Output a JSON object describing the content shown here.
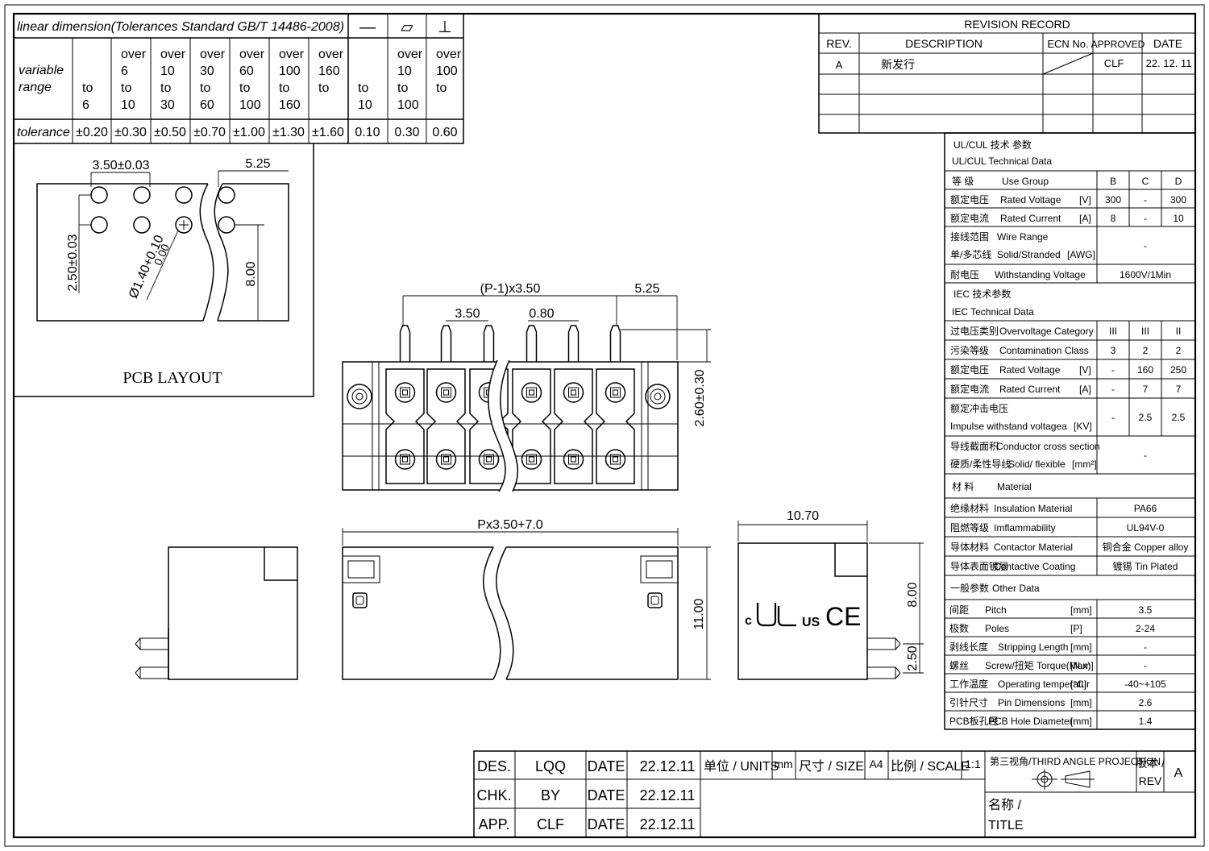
{
  "tolerance_table": {
    "header": "linear dimension(Tolerances Standard GB/T 14486-2008)",
    "symbols": [
      "—",
      "▱",
      "⊥"
    ],
    "row_label_range": [
      "variable",
      "range"
    ],
    "row_label_tol": "tolerance",
    "ranges": [
      [
        "",
        "",
        "to",
        "6"
      ],
      [
        "over",
        "6",
        "to",
        "10"
      ],
      [
        "over",
        "10",
        "to",
        "30"
      ],
      [
        "over",
        "30",
        "to",
        "60"
      ],
      [
        "over",
        "60",
        "to",
        "100"
      ],
      [
        "over",
        "100",
        "to",
        "160"
      ],
      [
        "over",
        "160",
        "to",
        ""
      ],
      [
        "",
        "",
        "to",
        "10"
      ],
      [
        "over",
        "10",
        "to",
        "100"
      ],
      [
        "over",
        "100",
        "to",
        ""
      ]
    ],
    "tolerances": [
      "±0.20",
      "±0.30",
      "±0.50",
      "±0.70",
      "±1.00",
      "±1.30",
      "±1.60",
      "0.10",
      "0.30",
      "0.60"
    ]
  },
  "revision": {
    "title": "REVISION  RECORD",
    "headers": [
      "REV.",
      "DESCRIPTION",
      "ECN No.",
      "APPROVED",
      "DATE"
    ],
    "rows": [
      [
        "A",
        "新发行",
        "",
        "CLF",
        "22. 12. 11"
      ]
    ]
  },
  "pcb_layout": {
    "title": "PCB LAYOUT",
    "dims": {
      "pitch": "3.50±0.03",
      "end": "5.25",
      "row_offset": "2.50±0.03",
      "hole": "Ø1.40+0.10",
      "hole_minus": "0.00",
      "depth": "8.00"
    }
  },
  "top_view": {
    "dims": {
      "span": "(P-1)x3.50",
      "end": "5.25",
      "pitch": "3.50",
      "pin": "0.80",
      "height": "2.60±0.30"
    }
  },
  "front_view": {
    "dims": {
      "length": "Px3.50+7.0",
      "height": "11.00"
    }
  },
  "side_view": {
    "dims": {
      "width": "10.70",
      "upper": "8.00",
      "lower": "2.50"
    },
    "marks": {
      "ul": "c",
      "us": "US",
      "ce": "CE"
    }
  },
  "tech": {
    "ul_title_cn": "UL/CUL    技术 参数",
    "ul_title_en": "UL/CUL    Technical Data",
    "use_group": {
      "cn": "等 级",
      "en": "Use Group",
      "vals": [
        "B",
        "C",
        "D"
      ]
    },
    "ul_rows": [
      {
        "cn": "额定电压",
        "en": "Rated Voltage",
        "unit": "[V]",
        "vals": [
          "300",
          "-",
          "300"
        ]
      },
      {
        "cn": "额定电流",
        "en": "Rated Current",
        "unit": "[A]",
        "vals": [
          "8",
          "-",
          "10"
        ]
      }
    ],
    "wire": {
      "cn1": "接线范围",
      "en1": "Wire Range",
      "cn2": "单/多芯线",
      "en2": "Solid/Stranded",
      "unit": "[AWG]",
      "val": "-"
    },
    "withstand": {
      "cn": "耐电压",
      "en": "Withstanding Voltage",
      "val": "1600V/1Min"
    },
    "iec_title_cn": "IEC  技术参数",
    "iec_title_en": "IEC  Technical Data",
    "iec_rows": [
      {
        "cn": "过电压类别",
        "en": "Overvoltage Category",
        "unit": "",
        "vals": [
          "III",
          "III",
          "II"
        ]
      },
      {
        "cn": "污染等级",
        "en": "Contamination Class",
        "unit": "",
        "vals": [
          "3",
          "2",
          "2"
        ]
      },
      {
        "cn": "额定电压",
        "en": "Rated Voltage",
        "unit": "[V]",
        "vals": [
          "-",
          "160",
          "250"
        ]
      },
      {
        "cn": "额定电流",
        "en": "Rated Current",
        "unit": "[A]",
        "vals": [
          "-",
          "7",
          "7"
        ]
      }
    ],
    "impulse": {
      "cn": "额定冲击电压",
      "en": "Impulse withstand voltagea",
      "unit": "[KV]",
      "vals": [
        "-",
        "2.5",
        "2.5"
      ]
    },
    "conductor": {
      "cn1": "导线截面积",
      "en1": "Conductor cross section",
      "cn2": "硬质/柔性导线",
      "en2": "Solid/ flexible",
      "unit": "[mm²]",
      "val": "-"
    },
    "material": {
      "cn": "材 料",
      "en": "Material"
    },
    "mat_rows": [
      {
        "cn": "绝缘材料",
        "en": "Insulation Material",
        "val": "PA66"
      },
      {
        "cn": "阻燃等级",
        "en": "Imflammability",
        "val": "UL94V-0"
      },
      {
        "cn": "导体材料",
        "en": "Contactor Material",
        "val": "铜合金 Copper alloy"
      },
      {
        "cn": "导体表面镀层",
        "en": "Contactive Coating",
        "val": "镀锡 Tin Plated"
      }
    ],
    "other": {
      "cn": "一般参数",
      "en": "Other Data"
    },
    "other_rows": [
      {
        "cn": "间距",
        "en": "Pitch",
        "unit": "[mm]",
        "val": "3.5"
      },
      {
        "cn": "极数",
        "en": "Poles",
        "unit": "[P]",
        "val": "2-24"
      },
      {
        "cn": "剥线长度",
        "en": "Stripping Length",
        "unit": "[mm]",
        "val": "-"
      },
      {
        "cn": "螺丝",
        "en": "Screw/扭矩  Torque(Max)",
        "unit": "[N.m]",
        "val": "-"
      },
      {
        "cn": "工作温度",
        "en": "Operating temperatur",
        "unit": "[°C]",
        "val": "-40~+105"
      },
      {
        "cn": "引针尺寸",
        "en": "Pin Dimensions",
        "unit": "[mm]",
        "val": "2.6"
      },
      {
        "cn": "PCB板孔径",
        "en": "PCB Hole Diameter",
        "unit": "[mm]",
        "val": "1.4"
      }
    ]
  },
  "title_block": {
    "rows": [
      {
        "role": "DES.",
        "name": "LQQ",
        "date_label": "DATE",
        "date": "22.12.11"
      },
      {
        "role": "CHK.",
        "name": "BY",
        "date_label": "DATE",
        "date": "22.12.11"
      },
      {
        "role": "APP.",
        "name": "CLF",
        "date_label": "DATE",
        "date": "22.12.11"
      }
    ],
    "units_label": "单位 / UNITS",
    "units": "mm",
    "size_label": "尺寸 / SIZE",
    "size": "A4",
    "scale_label": "比例 / SCALE",
    "scale": "1:1",
    "projection": "第三视角/THIRD ANGLE PROJECTION",
    "rev_label_cn": "版本 /",
    "rev_label_en": "REV",
    "rev": "A",
    "title_label_cn": "名称 /",
    "title_label_en": "TITLE"
  }
}
